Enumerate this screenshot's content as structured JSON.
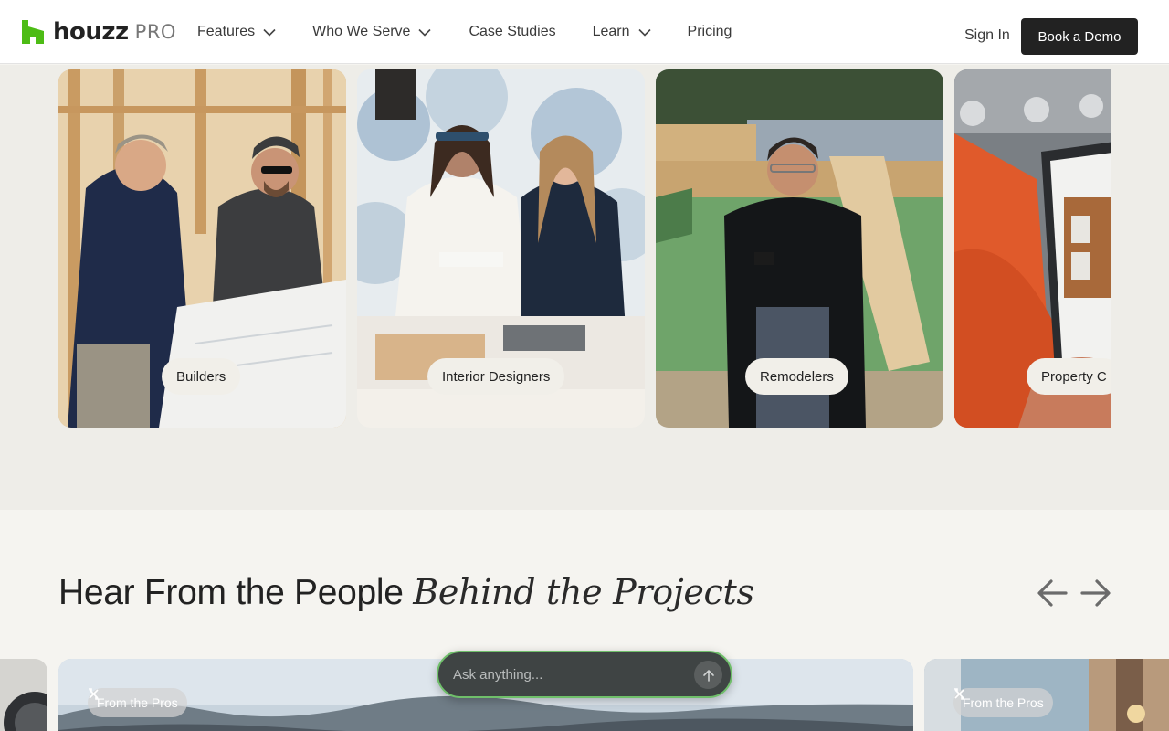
{
  "header": {
    "logo_word": "houzz",
    "logo_suffix": "PRO",
    "nav": [
      {
        "label": "Features",
        "has_dropdown": true
      },
      {
        "label": "Who We Serve",
        "has_dropdown": true
      },
      {
        "label": "Case Studies",
        "has_dropdown": false
      },
      {
        "label": "Learn",
        "has_dropdown": true
      },
      {
        "label": "Pricing",
        "has_dropdown": false
      }
    ],
    "sign_in": "Sign In",
    "cta": "Book a Demo"
  },
  "categories": [
    {
      "label": "Builders"
    },
    {
      "label": "Interior Designers"
    },
    {
      "label": "Remodelers"
    },
    {
      "label": "Property C"
    }
  ],
  "testimonials": {
    "title_plain": "Hear From the People ",
    "title_italic": "Behind the Projects",
    "cards": [
      {
        "tag": "From the Pros"
      },
      {
        "tag": "From the Pros"
      }
    ]
  },
  "ask": {
    "placeholder": "Ask anything..."
  },
  "colors": {
    "brand_green": "#4dbc15",
    "cta_bg": "#222222",
    "ask_bg": "#3f4444",
    "ask_border": "#6fbf6a"
  }
}
